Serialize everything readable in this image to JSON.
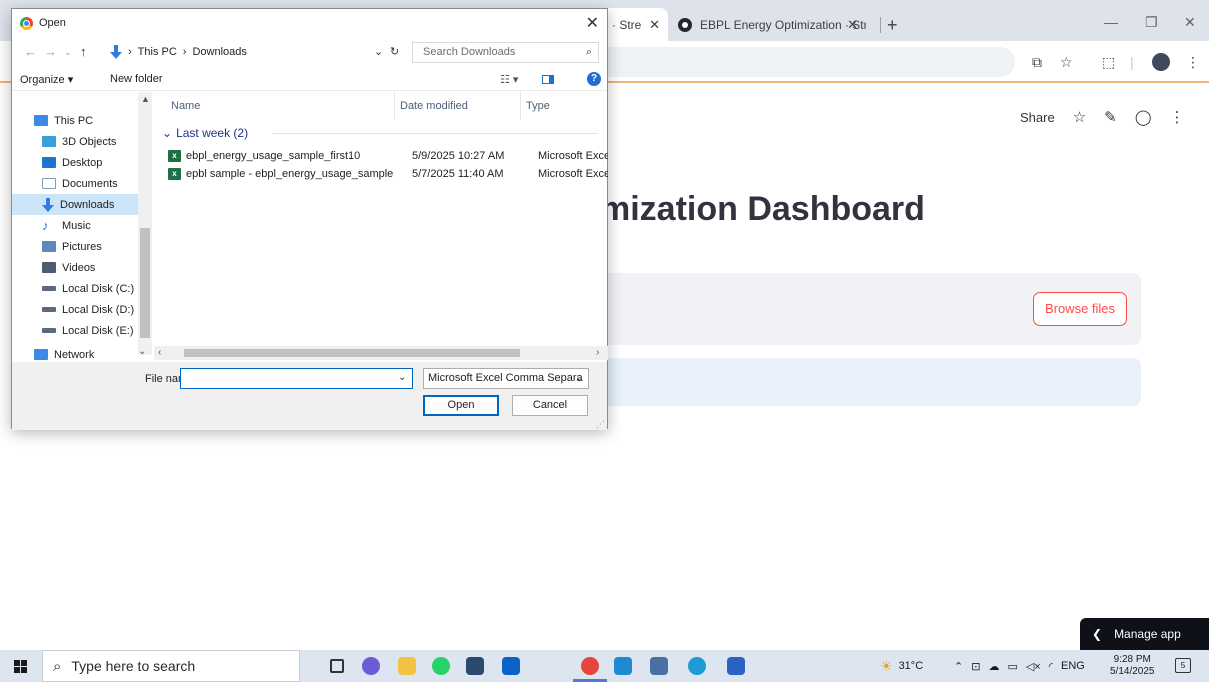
{
  "browser": {
    "tab1_title": "n · Stre",
    "tab2_title": "EBPL Energy Optimization · Stre",
    "tab_close": "✕",
    "new_tab": "+",
    "minimize": "—",
    "restore": "❐",
    "close": "✕"
  },
  "streamlit": {
    "share_label": "Share",
    "page_title": "mization Dashboard",
    "browse_label": "Browse files",
    "manage_label": "Manage app"
  },
  "dialog": {
    "title": "Open",
    "breadcrumb": [
      "This PC",
      "Downloads"
    ],
    "search_placeholder": "Search Downloads",
    "organize_label": "Organize ▾",
    "new_folder_label": "New folder",
    "nav_items": [
      {
        "label": "This PC",
        "color": "#3c8ae8"
      },
      {
        "label": "3D Objects",
        "color": "#3aa0d8"
      },
      {
        "label": "Desktop",
        "color": "#1f72d1"
      },
      {
        "label": "Documents",
        "color": "#8a9bb0"
      },
      {
        "label": "Downloads",
        "color": "#2f7de1"
      },
      {
        "label": "Music",
        "color": "#1f72d1"
      },
      {
        "label": "Pictures",
        "color": "#5d88b8"
      },
      {
        "label": "Videos",
        "color": "#4d5c6e"
      },
      {
        "label": "Local Disk (C:)",
        "color": "#5a6a7c"
      },
      {
        "label": "Local Disk (D:)",
        "color": "#5a6a7c"
      },
      {
        "label": "Local Disk (E:)",
        "color": "#5a6a7c"
      }
    ],
    "network_label": "Network",
    "columns": {
      "name": "Name",
      "date": "Date modified",
      "type": "Type"
    },
    "group_label": "Last week (2)",
    "files": [
      {
        "name": "ebpl_energy_usage_sample_first10",
        "date": "5/9/2025 10:27 AM",
        "type": "Microsoft Excel"
      },
      {
        "name": "epbl sample - ebpl_energy_usage_sample",
        "date": "5/7/2025 11:40 AM",
        "type": "Microsoft Excel"
      }
    ],
    "file_name_label": "File name:",
    "file_name_value": "",
    "file_type_value": "Microsoft Excel Comma Separa",
    "open_label": "Open",
    "cancel_label": "Cancel"
  },
  "taskbar": {
    "search_placeholder": "Type here to search",
    "weather": "31°C",
    "language": "ENG",
    "time": "9:28 PM",
    "date": "5/14/2025",
    "notification_count": "5"
  }
}
